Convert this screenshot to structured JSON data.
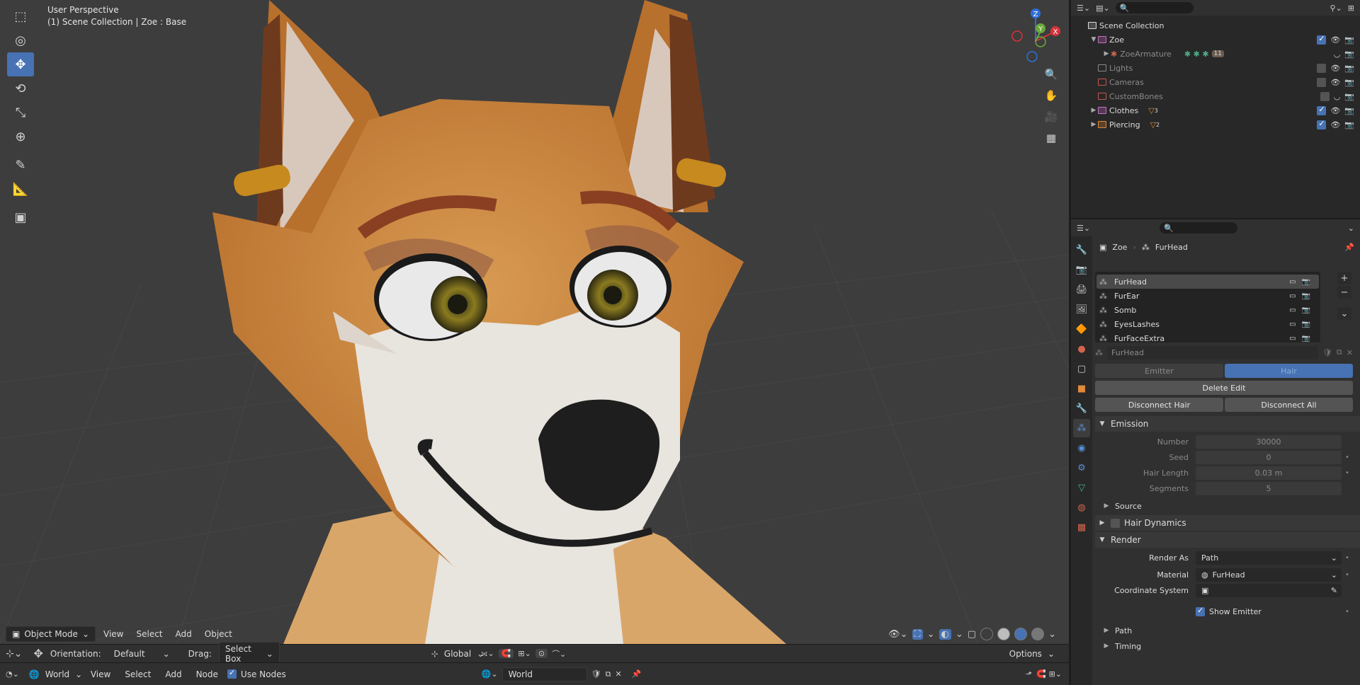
{
  "viewport": {
    "title": "User Perspective",
    "subtitle": "(1) Scene Collection | Zoe  : Base",
    "header": {
      "mode": "Object Mode",
      "menus": [
        "View",
        "Select",
        "Add",
        "Object"
      ]
    },
    "gizmo": {
      "z": "Z",
      "y": "Y",
      "x": "X"
    }
  },
  "tool_settings": {
    "orientation_label": "Orientation:",
    "orientation_value": "Default",
    "drag_label": "Drag:",
    "drag_value": "Select Box",
    "transform_orientation": "Global",
    "options": "Options"
  },
  "shader_bar": {
    "type": "World",
    "menus": [
      "View",
      "Select",
      "Add",
      "Node"
    ],
    "use_nodes": "Use Nodes",
    "world_name": "World"
  },
  "outliner": {
    "root": "Scene Collection",
    "items": [
      {
        "label": "Zoe",
        "color": "#c86fc8",
        "checked": true
      },
      {
        "label": "ZoeArmature",
        "color": "#9a9a9a",
        "checked": false
      },
      {
        "label": "Lights",
        "color": "#8a8a8a",
        "checked": false
      },
      {
        "label": "Cameras",
        "color": "#c8554c",
        "checked": false
      },
      {
        "label": "CustomBones",
        "color": "#c8554c",
        "checked": false
      },
      {
        "label": "Clothes",
        "color": "#c86fc8",
        "checked": true
      },
      {
        "label": "Piercing",
        "color": "#e08a3a",
        "checked": true
      }
    ],
    "armature_count": "11",
    "clothes_count": "3",
    "piercing_count": "2"
  },
  "properties": {
    "breadcrumb": {
      "object": "Zoe",
      "system": "FurHead"
    },
    "systems": [
      "FurHead",
      "FurEar",
      "Somb",
      "EyesLashes",
      "FurFaceExtra"
    ],
    "settings_name": "FurHead",
    "type_tabs": [
      "Emitter",
      "Hair"
    ],
    "delete_edit": "Delete Edit",
    "disconnect_hair": "Disconnect Hair",
    "disconnect_all": "Disconnect All",
    "emission": {
      "title": "Emission",
      "fields": [
        {
          "label": "Number",
          "value": "30000"
        },
        {
          "label": "Seed",
          "value": "0"
        },
        {
          "label": "Hair Length",
          "value": "0.03 m"
        },
        {
          "label": "Segments",
          "value": "5"
        }
      ]
    },
    "source": "Source",
    "hair_dynamics": "Hair Dynamics",
    "render": {
      "title": "Render",
      "render_as_label": "Render As",
      "render_as_value": "Path",
      "material_label": "Material",
      "material_value": "FurHead",
      "coord_label": "Coordinate System",
      "show_emitter": "Show Emitter"
    },
    "path": "Path",
    "timing": "Timing"
  }
}
